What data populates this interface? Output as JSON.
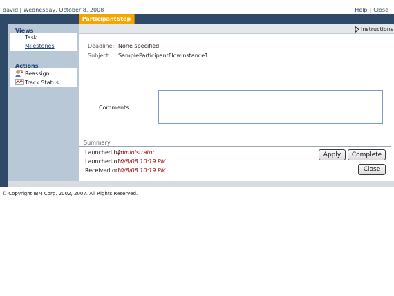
{
  "header": {
    "user_date": "david | Wednesday, October 8, 2008",
    "help_label": "Help",
    "separator": "|",
    "close_label": "Close"
  },
  "tab": {
    "label": "ParticipantStep"
  },
  "sidebar": {
    "views_title": "Views",
    "views": [
      {
        "label": "Task",
        "active": true
      },
      {
        "label": "Milestones",
        "active": false
      }
    ],
    "actions_title": "Actions",
    "actions": [
      {
        "label": "Reassign",
        "icon": "reassign-icon"
      },
      {
        "label": "Track Status",
        "icon": "track-status-icon"
      }
    ]
  },
  "instructions": {
    "label": "Instructions"
  },
  "details": {
    "deadline_label": "Deadline:",
    "deadline_value": "None specified",
    "subject_label": "Subject:",
    "subject_value": "SampleParticipantFlowInstance1",
    "comments_label": "Comments:",
    "comments_value": ""
  },
  "summary": {
    "title": "Summary:",
    "launched_by_label": "Launched by:",
    "launched_by_value": "Administrator",
    "launched_on_label": "Launched on:",
    "launched_on_value": "10/8/08 10:19 PM",
    "received_on_label": "Received on:",
    "received_on_value": "10/8/08 10:19 PM"
  },
  "buttons": {
    "apply": "Apply",
    "complete": "Complete",
    "close": "Close"
  },
  "footer": {
    "copyright": "© Copyright IBM Corp. 2002, 2007. All Rights Reserved."
  },
  "colors": {
    "frame_dark": "#2e4a68",
    "tab_orange": "#f4a600",
    "sidebar_bg": "#b8c8d6",
    "link_blue": "#1d3c74",
    "value_red": "#a01010"
  }
}
